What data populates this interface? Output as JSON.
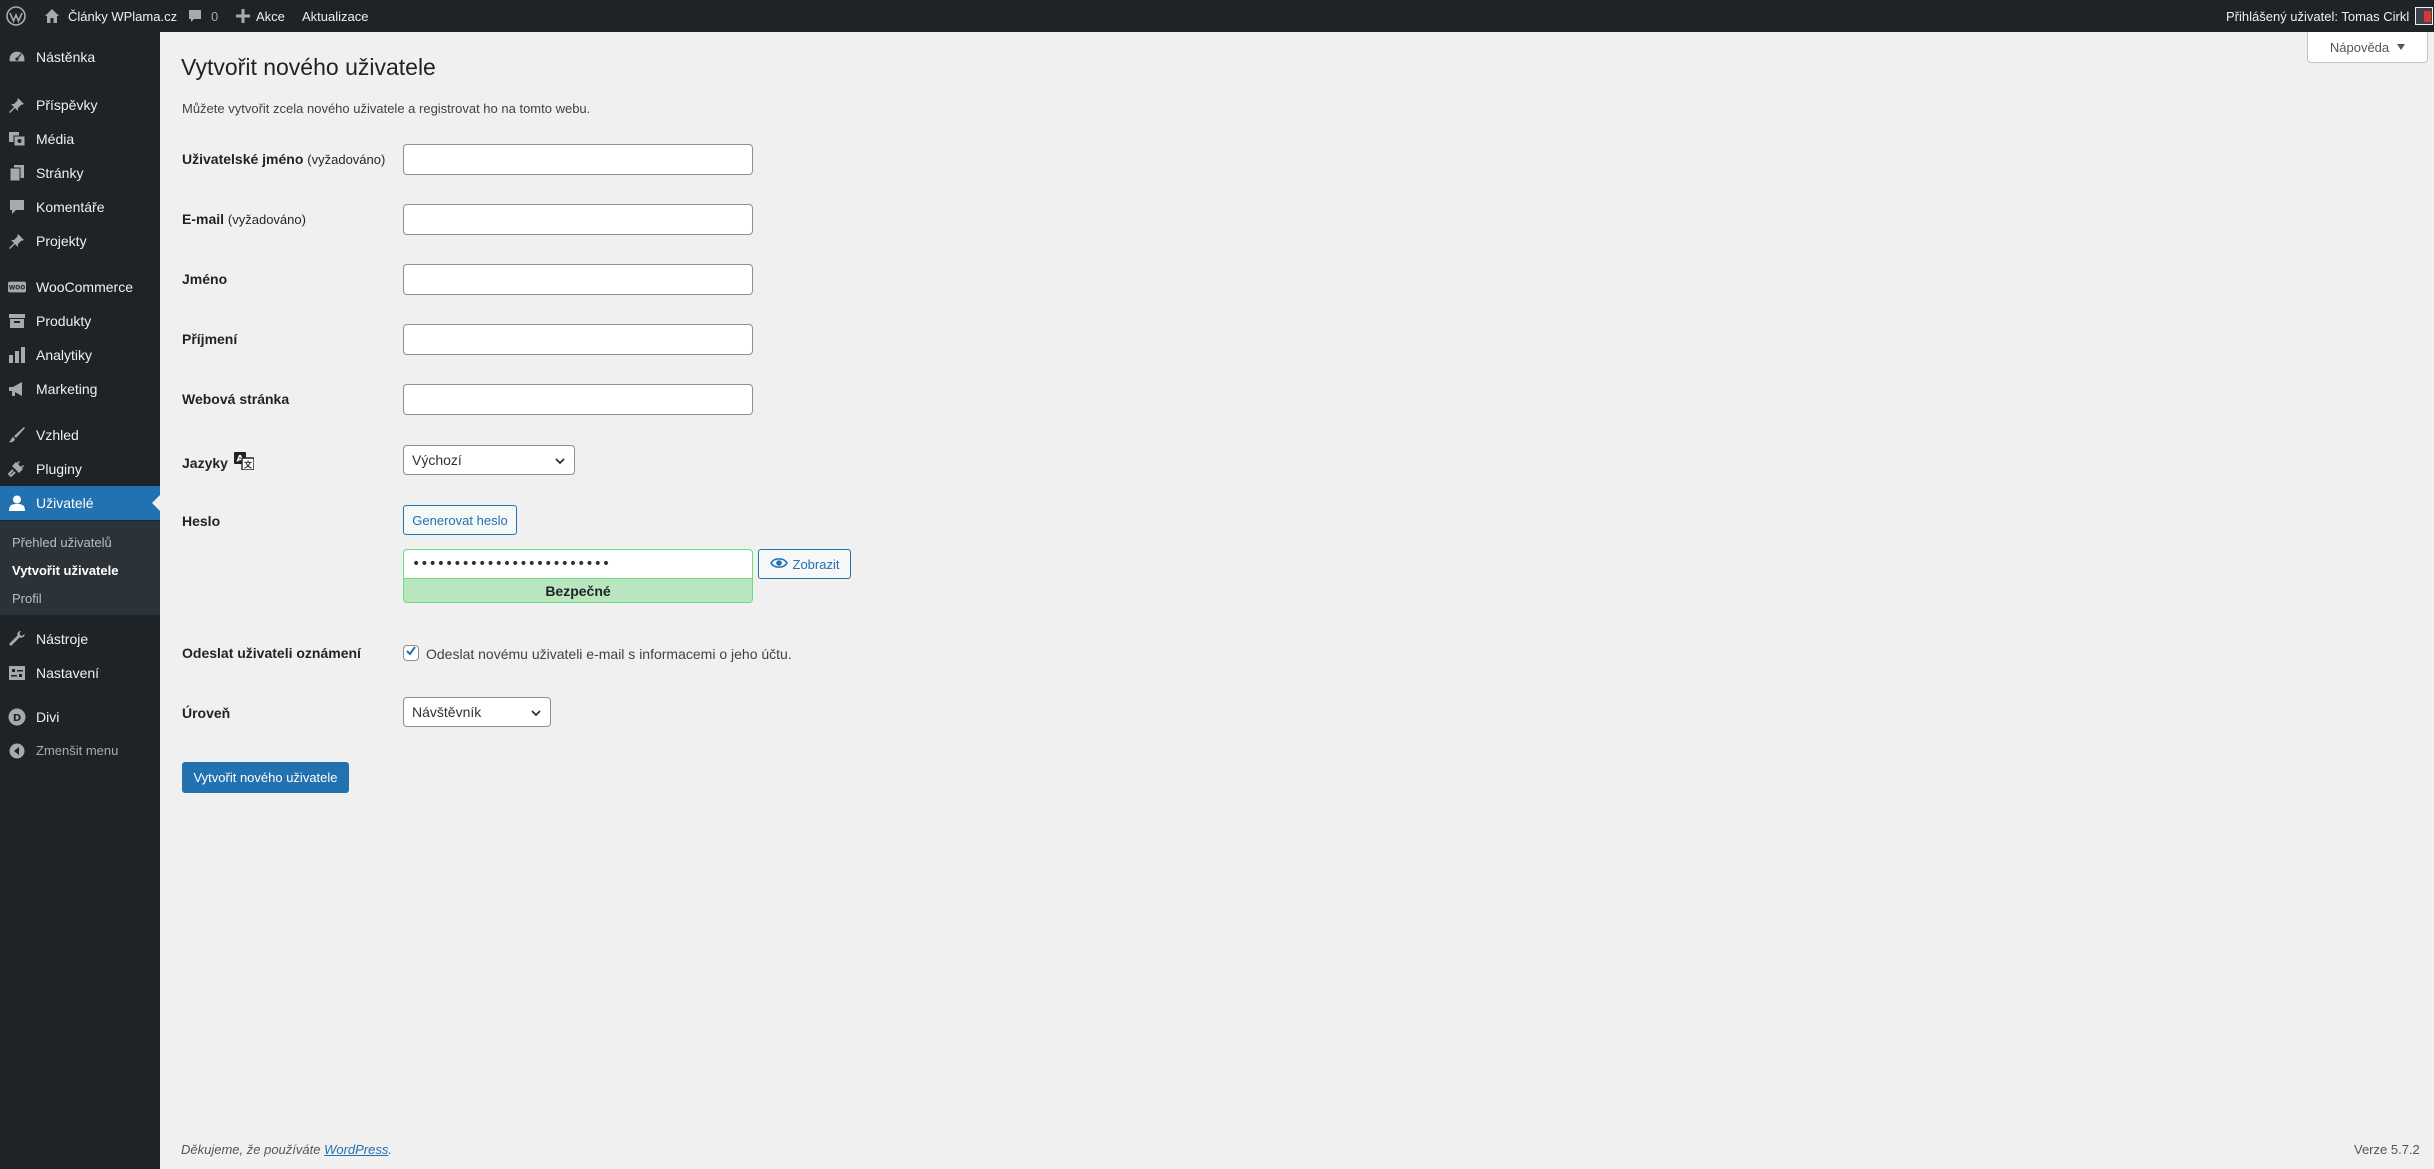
{
  "adminbar": {
    "site_name": "Články WPlama.cz",
    "comments_count": "0",
    "new_label": "Akce",
    "updates_label": "Aktualizace",
    "account_label": "Přihlášený uživatel: Tomas Cirkl"
  },
  "sidebar": {
    "items": [
      {
        "label": "Nástěnka",
        "icon": "dashboard-icon"
      },
      {
        "label": "Příspěvky",
        "icon": "pin-icon"
      },
      {
        "label": "Média",
        "icon": "media-icon"
      },
      {
        "label": "Stránky",
        "icon": "pages-icon"
      },
      {
        "label": "Komentáře",
        "icon": "comments-icon"
      },
      {
        "label": "Projekty",
        "icon": "pin-icon"
      },
      {
        "label": "WooCommerce",
        "icon": "woo-icon"
      },
      {
        "label": "Produkty",
        "icon": "archive-icon"
      },
      {
        "label": "Analytiky",
        "icon": "bar-chart-icon"
      },
      {
        "label": "Marketing",
        "icon": "megaphone-icon"
      },
      {
        "label": "Vzhled",
        "icon": "brush-icon"
      },
      {
        "label": "Pluginy",
        "icon": "plug-icon"
      },
      {
        "label": "Uživatelé",
        "icon": "user-icon"
      },
      {
        "label": "Nástroje",
        "icon": "wrench-icon"
      },
      {
        "label": "Nastavení",
        "icon": "settings-icon"
      },
      {
        "label": "Divi",
        "icon": "divi-icon"
      }
    ],
    "submenu": [
      "Přehled uživatelů",
      "Vytvořit uživatele",
      "Profil"
    ],
    "collapse_label": "Zmenšit menu"
  },
  "help_tab": "Nápověda",
  "page": {
    "title": "Vytvořit nového uživatele",
    "intro": "Můžete vytvořit zcela nového uživatele a registrovat ho na tomto webu."
  },
  "form": {
    "username_label": "Uživatelské jméno",
    "required_note": "(vyžadováno)",
    "email_label": "E-mail",
    "first_name_label": "Jméno",
    "last_name_label": "Příjmení",
    "website_label": "Webová stránka",
    "language_label": "Jazyky",
    "language_value": "Výchozí",
    "password_label": "Heslo",
    "generate_password": "Generovat heslo",
    "password_mask": "••••••••••••••••••••••••",
    "password_strength": "Bezpečné",
    "show_password": "Zobrazit",
    "notify_label": "Odeslat uživateli oznámení",
    "notify_text": "Odeslat novému uživateli e-mail s informacemi o jeho účtu.",
    "role_label": "Úroveň",
    "role_value": "Návštěvník",
    "submit": "Vytvořit nového uživatele"
  },
  "footer": {
    "thanks_prefix": "Děkujeme, že používáte ",
    "thanks_link": "WordPress",
    "thanks_suffix": ".",
    "version": "Verze 5.7.2"
  },
  "colors": {
    "accent": "#2271b1",
    "adminbar": "#1d2327",
    "strength_good": "#b8e6bf"
  }
}
